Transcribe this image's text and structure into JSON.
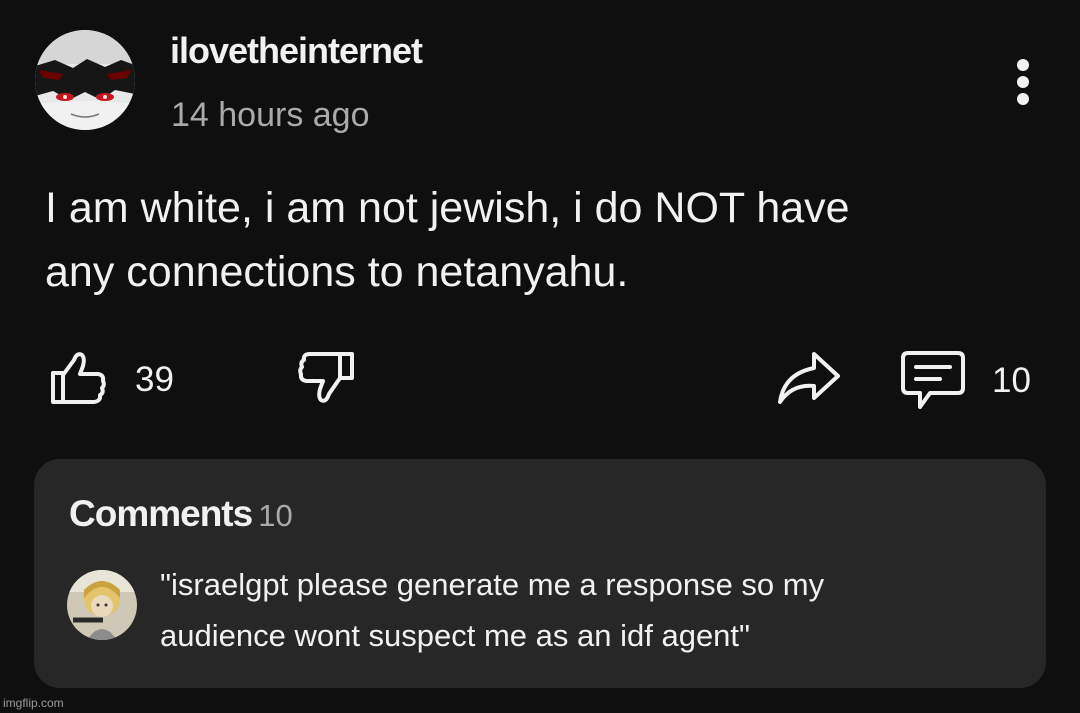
{
  "post": {
    "author": {
      "username": "ilovetheinternet",
      "avatar_icon": "channel-avatar"
    },
    "timestamp": "14 hours ago",
    "body_lines": [
      "I am white, i am not jewish, i do NOT have",
      "any connections to netanyahu."
    ],
    "actions": {
      "like": {
        "icon": "thumbs-up-icon",
        "count": "39"
      },
      "dislike": {
        "icon": "thumbs-down-icon"
      },
      "share": {
        "icon": "share-icon"
      },
      "comment": {
        "icon": "comment-icon",
        "count": "10"
      },
      "menu": {
        "icon": "more-vertical-icon"
      }
    }
  },
  "comments": {
    "title": "Comments",
    "count": "10",
    "top_comment": {
      "avatar_icon": "commenter-avatar",
      "text_lines": [
        "\"israelgpt please generate me a response so my",
        "audience wont suspect me as an idf agent\""
      ]
    }
  },
  "watermark": "imgflip.com",
  "colors": {
    "background": "#0f0f0f",
    "panel": "#272727",
    "text_primary": "#f1f1f1",
    "text_secondary": "#aaaaaa"
  }
}
